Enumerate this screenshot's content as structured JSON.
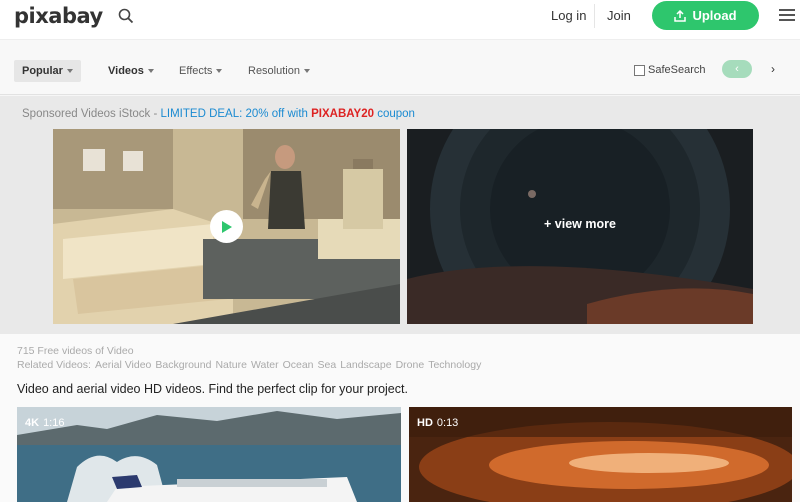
{
  "header": {
    "logo": "pixabay",
    "login": "Log in",
    "join": "Join",
    "upload": "Upload"
  },
  "filters": {
    "popular": "Popular",
    "videos": "Videos",
    "effects": "Effects",
    "resolution": "Resolution",
    "safesearch": "SafeSearch",
    "prev": "‹",
    "next": "›"
  },
  "sponsored": {
    "prefix": "Sponsored Videos iStock - ",
    "deal": "LIMITED DEAL: 20% off with ",
    "code": "PIXABAY20",
    "suffix": " coupon",
    "view_more": "+ view more"
  },
  "info": {
    "count": "715 Free videos of Video",
    "related_label": "Related Videos:",
    "related": [
      "Aerial Video",
      "Background",
      "Nature",
      "Water",
      "Ocean",
      "Sea",
      "Landscape",
      "Drone",
      "Technology"
    ],
    "description": "Video and aerial video HD videos. Find the perfect clip for your project."
  },
  "videos": [
    {
      "quality": "4K",
      "duration": "1:16"
    },
    {
      "quality": "HD",
      "duration": "0:13"
    }
  ],
  "colors": {
    "accent": "#2ec66d",
    "link": "#1a8ad1",
    "coupon": "#dd2222"
  }
}
